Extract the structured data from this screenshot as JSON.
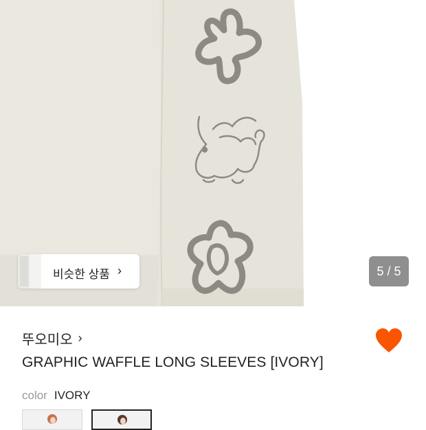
{
  "gallery": {
    "counter": "5 / 5",
    "similar_products_label": "비슷한 상품",
    "similar_chevron": "›"
  },
  "product": {
    "brand": "뚜오미오",
    "brand_chevron": "›",
    "title": "GRAPHIC WAFFLE LONG SLEEVES [IVORY]",
    "liked": true,
    "color_label": "color",
    "color_value": "IVORY",
    "color_options_count": 2
  },
  "colors": {
    "heart": "#fa5500",
    "fabric": "#e8e6dd",
    "print": "#8c8a82"
  }
}
